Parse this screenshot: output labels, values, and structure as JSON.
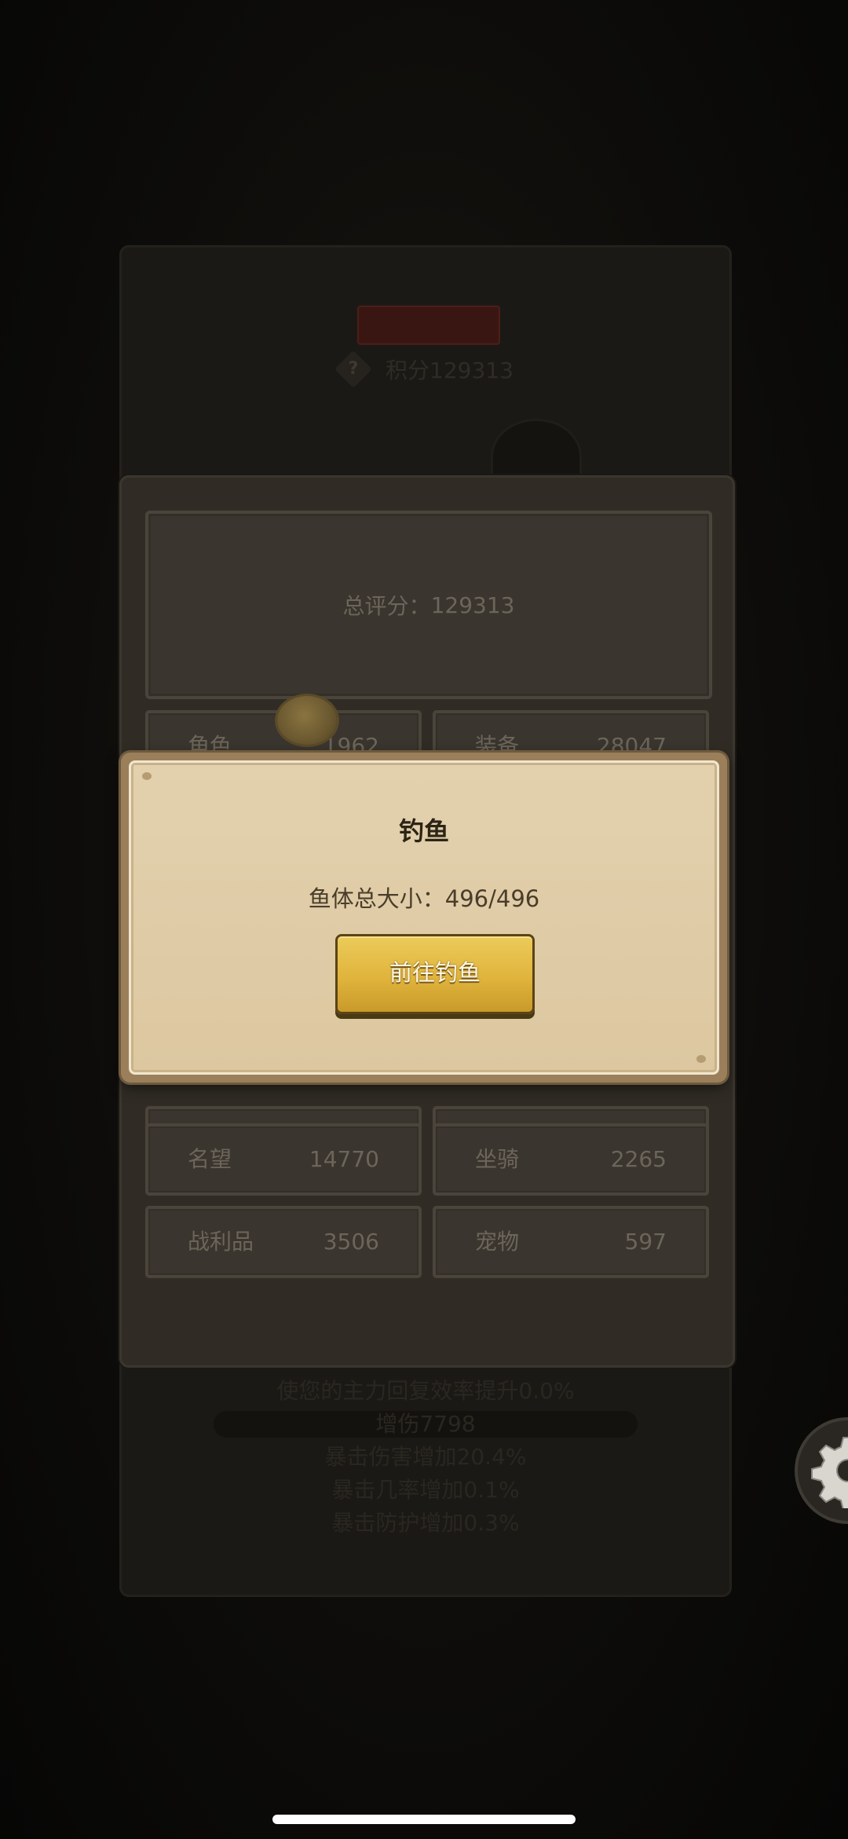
{
  "background_panel": {
    "badge_text": "",
    "score_text": "积分129313",
    "help_icon": "?",
    "lines": [
      "使您的主力回复效率提升0.0%",
      "增伤7798",
      "暴击伤害增加20.4%",
      "暴击几率增加0.1%",
      "暴击防护增加0.3%"
    ]
  },
  "score_panel": {
    "total_label": "总评分：",
    "total_value": "129313",
    "stats": [
      {
        "name": "角色",
        "value": "1962"
      },
      {
        "name": "装备",
        "value": "28047"
      },
      {
        "name": "名望",
        "value": "14770"
      },
      {
        "name": "坐骑",
        "value": "2265"
      },
      {
        "name": "战利品",
        "value": "3506"
      },
      {
        "name": "宠物",
        "value": "597"
      }
    ]
  },
  "dialog": {
    "title": "钓鱼",
    "text": "鱼体总大小：496/496",
    "button_label": "前往钓鱼"
  },
  "icons": {
    "settings": "gear-icon",
    "coin": "coin-icon"
  },
  "colors": {
    "dialog_bg": "#e3d1ae",
    "button_gold": "#e0b43d",
    "panel_dark": "#302c25"
  }
}
